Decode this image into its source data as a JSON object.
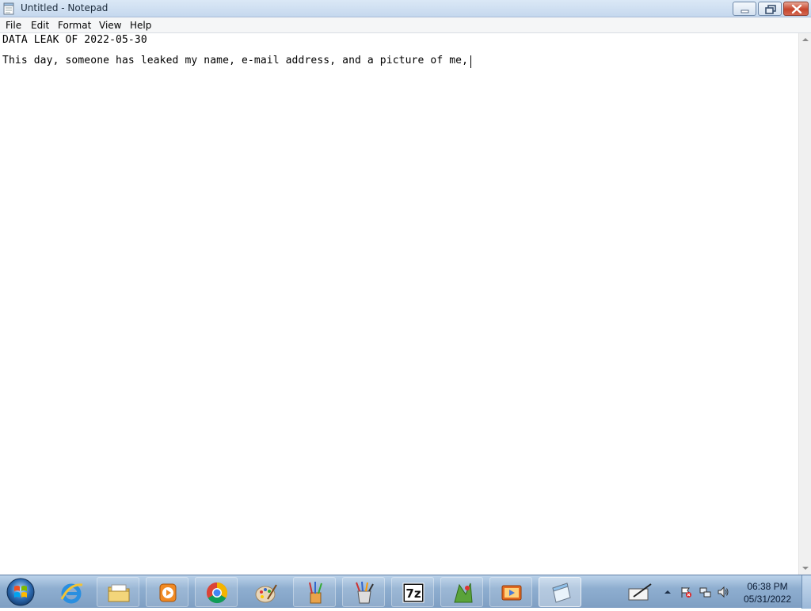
{
  "window": {
    "title": "Untitled - Notepad",
    "icon": "notepad-icon"
  },
  "menu": {
    "items": [
      "File",
      "Edit",
      "Format",
      "View",
      "Help"
    ]
  },
  "document": {
    "lines": [
      "DATA LEAK OF 2022-05-30",
      "This day, someone has leaked my name, e-mail address, and a picture of me,"
    ]
  },
  "taskbar": {
    "start_icon": "windows-start-icon",
    "apps": [
      {
        "name": "internet-explorer-icon",
        "pinned": true
      },
      {
        "name": "file-explorer-icon",
        "pinned": false
      },
      {
        "name": "media-player-icon",
        "pinned": false
      },
      {
        "name": "chrome-icon",
        "pinned": false
      },
      {
        "name": "paint-palette-icon",
        "pinned": true
      },
      {
        "name": "brushes-app-icon",
        "pinned": false
      },
      {
        "name": "paint-bucket-app-icon",
        "pinned": false
      },
      {
        "name": "7zip-icon",
        "pinned": false
      },
      {
        "name": "green-app-icon",
        "pinned": false
      },
      {
        "name": "video-app-icon",
        "pinned": false
      },
      {
        "name": "notepad-taskbar-icon",
        "pinned": false
      }
    ]
  },
  "tray": {
    "icons": [
      "pen-tablet-icon",
      "show-hidden-icons-chevron",
      "action-center-flag-icon",
      "network-icon",
      "volume-icon"
    ],
    "time": "06:38 PM",
    "date": "05/31/2022"
  },
  "colors": {
    "title_bar": "#c5d8ee",
    "close_button": "#c6452c",
    "taskbar": "#8eaed0"
  }
}
